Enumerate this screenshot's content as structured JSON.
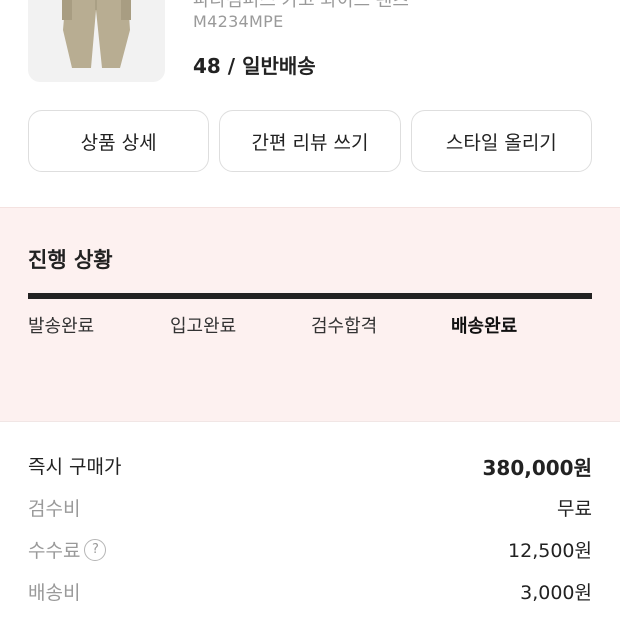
{
  "product": {
    "name_partial": "파라점퍼스 카고 와이드 팬츠",
    "code": "M4234MPE",
    "size_delivery": "48 / 일반배송"
  },
  "actions": {
    "detail": "상품 상세",
    "review": "간편 리뷰 쓰기",
    "style": "스타일 올리기"
  },
  "progress": {
    "title": "진행 상황",
    "fraction": 1.0,
    "steps": [
      "발송완료",
      "입고완료",
      "검수합격",
      "배송완료"
    ],
    "active_index": 3
  },
  "fees": [
    {
      "label": "즉시 구매가",
      "value": "380,000원"
    },
    {
      "label": "검수비",
      "value": "무료"
    },
    {
      "label": "수수료",
      "value": "12,500원",
      "help": "?"
    },
    {
      "label": "배송비",
      "value": "3,000원"
    }
  ],
  "colors": {
    "panel_bg": "#fdf1f0",
    "text_primary": "#222222",
    "text_muted": "#9a9a9a"
  }
}
